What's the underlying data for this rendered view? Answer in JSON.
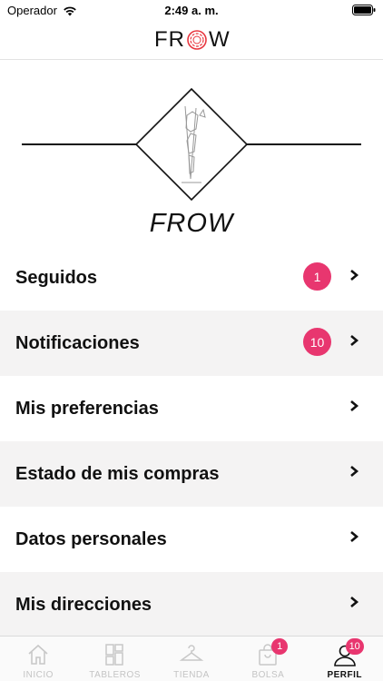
{
  "status_bar": {
    "carrier": "Operador",
    "time": "2:49 a. m."
  },
  "nav": {
    "logo_left": "FR",
    "logo_right": "W",
    "logo_icon": "frow-logo-icon"
  },
  "profile": {
    "name": "FROW",
    "emblem_icon": "hanger-rack-emblem-icon"
  },
  "menu": {
    "items": [
      {
        "label": "Seguidos",
        "badge": "1"
      },
      {
        "label": "Notificaciones",
        "badge": "10"
      },
      {
        "label": "Mis preferencias"
      },
      {
        "label": "Estado de mis compras"
      },
      {
        "label": "Datos personales"
      },
      {
        "label": "Mis direcciones"
      }
    ],
    "chevron_icon": "chevron-right-icon",
    "badge_color": "#e8366f"
  },
  "tab_bar": {
    "tabs": [
      {
        "label": "INICIO",
        "icon": "home-icon"
      },
      {
        "label": "TABLEROS",
        "icon": "boards-icon"
      },
      {
        "label": "TIENDA",
        "icon": "hanger-icon"
      },
      {
        "label": "BOLSA",
        "icon": "bag-icon",
        "badge": "1"
      },
      {
        "label": "PERFIL",
        "icon": "profile-icon",
        "badge": "10"
      }
    ],
    "active": "PERFIL"
  }
}
